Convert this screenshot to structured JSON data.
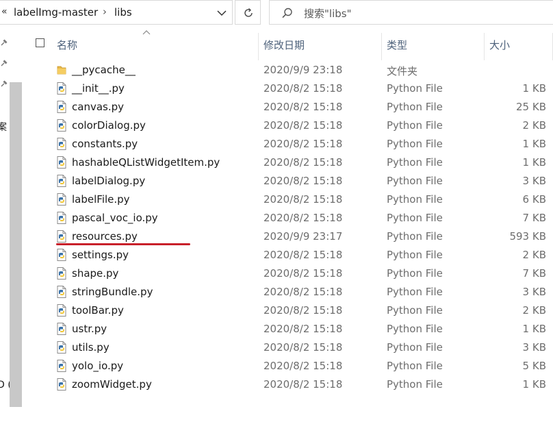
{
  "address_bar": {
    "overflow_glyph": "«",
    "breadcrumbs": [
      "labelImg-master",
      "libs"
    ],
    "separator": "›"
  },
  "search": {
    "placeholder": "搜索\"libs\""
  },
  "nav_fragments": [
    "案",
    "D ("
  ],
  "columns": {
    "name": "名称",
    "date": "修改日期",
    "type": "类型",
    "size": "大小"
  },
  "files": [
    {
      "name": "__pycache__",
      "date": "2020/9/9 23:18",
      "type": "文件夹",
      "size": "",
      "icon": "folder-icon"
    },
    {
      "name": "__init__.py",
      "date": "2020/8/2 15:18",
      "type": "Python File",
      "size": "1 KB",
      "icon": "python-file-icon"
    },
    {
      "name": "canvas.py",
      "date": "2020/8/2 15:18",
      "type": "Python File",
      "size": "25 KB",
      "icon": "python-file-icon"
    },
    {
      "name": "colorDialog.py",
      "date": "2020/8/2 15:18",
      "type": "Python File",
      "size": "2 KB",
      "icon": "python-file-icon"
    },
    {
      "name": "constants.py",
      "date": "2020/8/2 15:18",
      "type": "Python File",
      "size": "1 KB",
      "icon": "python-file-icon"
    },
    {
      "name": "hashableQListWidgetItem.py",
      "date": "2020/8/2 15:18",
      "type": "Python File",
      "size": "1 KB",
      "icon": "python-file-icon"
    },
    {
      "name": "labelDialog.py",
      "date": "2020/8/2 15:18",
      "type": "Python File",
      "size": "3 KB",
      "icon": "python-file-icon"
    },
    {
      "name": "labelFile.py",
      "date": "2020/8/2 15:18",
      "type": "Python File",
      "size": "6 KB",
      "icon": "python-file-icon"
    },
    {
      "name": "pascal_voc_io.py",
      "date": "2020/8/2 15:18",
      "type": "Python File",
      "size": "7 KB",
      "icon": "python-file-icon"
    },
    {
      "name": "resources.py",
      "date": "2020/9/9 23:17",
      "type": "Python File",
      "size": "593 KB",
      "icon": "python-file-icon",
      "highlight": true
    },
    {
      "name": "settings.py",
      "date": "2020/8/2 15:18",
      "type": "Python File",
      "size": "2 KB",
      "icon": "python-file-icon"
    },
    {
      "name": "shape.py",
      "date": "2020/8/2 15:18",
      "type": "Python File",
      "size": "7 KB",
      "icon": "python-file-icon"
    },
    {
      "name": "stringBundle.py",
      "date": "2020/8/2 15:18",
      "type": "Python File",
      "size": "3 KB",
      "icon": "python-file-icon"
    },
    {
      "name": "toolBar.py",
      "date": "2020/8/2 15:18",
      "type": "Python File",
      "size": "2 KB",
      "icon": "python-file-icon"
    },
    {
      "name": "ustr.py",
      "date": "2020/8/2 15:18",
      "type": "Python File",
      "size": "1 KB",
      "icon": "python-file-icon"
    },
    {
      "name": "utils.py",
      "date": "2020/8/2 15:18",
      "type": "Python File",
      "size": "3 KB",
      "icon": "python-file-icon"
    },
    {
      "name": "yolo_io.py",
      "date": "2020/8/2 15:18",
      "type": "Python File",
      "size": "5 KB",
      "icon": "python-file-icon"
    },
    {
      "name": "zoomWidget.py",
      "date": "2020/8/2 15:18",
      "type": "Python File",
      "size": "1 KB",
      "icon": "python-file-icon"
    }
  ],
  "colors": {
    "header_text": "#4c607a",
    "meta_text": "#6d6d6d",
    "highlight_underline": "#c8202a",
    "folder": "#e8b84a"
  }
}
